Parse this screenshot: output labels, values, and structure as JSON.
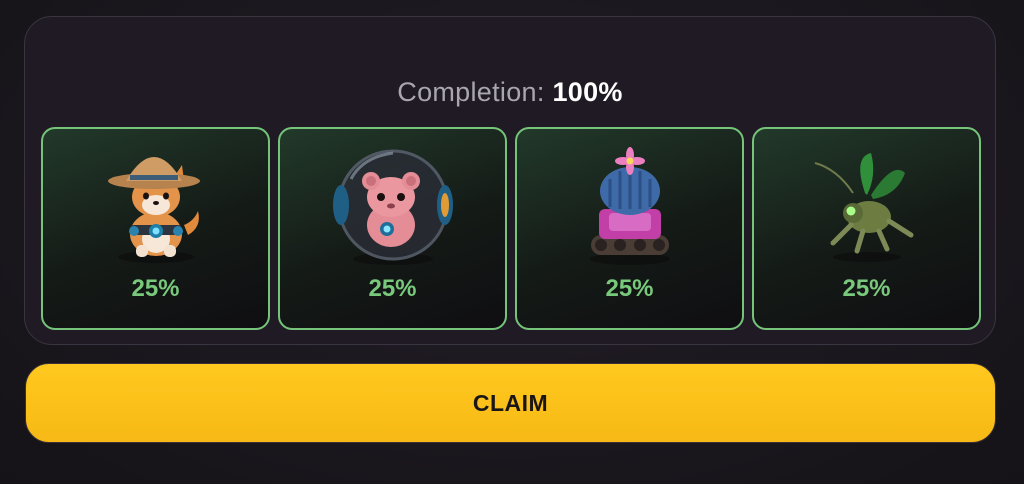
{
  "completion": {
    "label": "Completion:",
    "value": "100%"
  },
  "cards": [
    {
      "name": "shiba-dog-explorer",
      "icon": "dog-with-hat-icon",
      "percent": "25%"
    },
    {
      "name": "hamster-ball",
      "icon": "hamster-in-ball-icon",
      "percent": "25%"
    },
    {
      "name": "cactus-tank",
      "icon": "cactus-tank-icon",
      "percent": "25%"
    },
    {
      "name": "robot-bug",
      "icon": "robot-bug-icon",
      "percent": "25%"
    }
  ],
  "claim_button": {
    "label": "CLAIM"
  },
  "colors": {
    "accent_green": "#79c97c",
    "claim_yellow": "#fcc21b"
  }
}
